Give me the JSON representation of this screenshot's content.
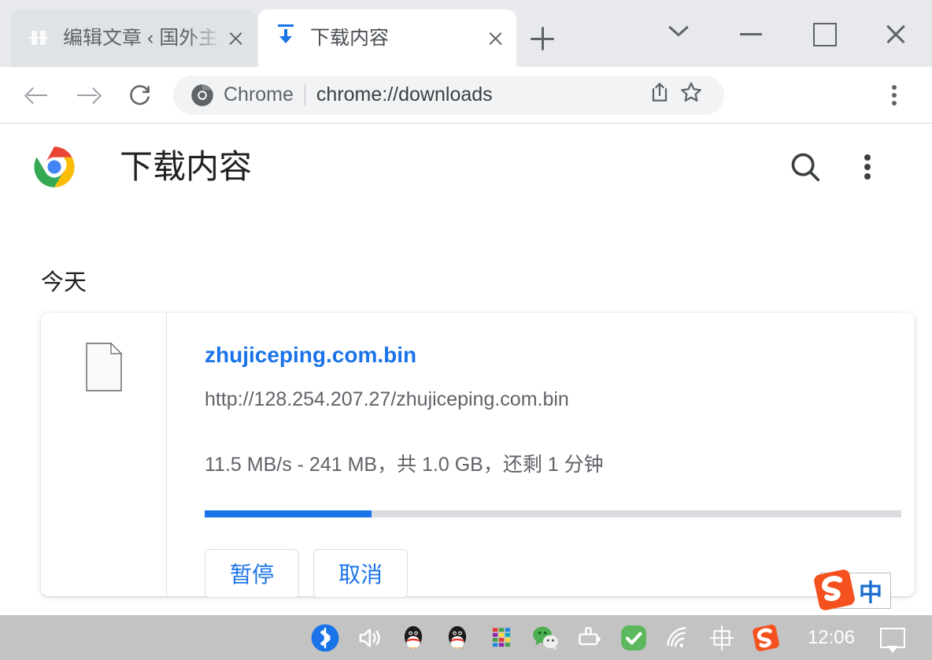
{
  "window": {
    "controls": {
      "tab_search": "tab-search",
      "minimize": "minimize",
      "maximize": "maximize",
      "close": "close"
    }
  },
  "tabs": [
    {
      "title": "编辑文章 ‹ 国外主",
      "favicon": "red-seal-icon",
      "active": false,
      "close_label": "×"
    },
    {
      "title": "下载内容",
      "favicon": "download-icon",
      "active": true,
      "close_label": "×"
    }
  ],
  "new_tab_label": "+",
  "toolbar": {
    "back": "back-arrow",
    "forward": "forward-arrow",
    "reload": "reload-icon",
    "omnibox": {
      "chip_label": "Chrome",
      "url": "chrome://downloads",
      "share_icon": "share-icon",
      "bookmark_icon": "star-icon"
    },
    "menu": "browser-menu"
  },
  "page": {
    "title": "下载内容",
    "watermark": "zhujiceping.com",
    "search_icon": "search-icon",
    "menu_icon": "more-vertical-icon",
    "date_group": "今天",
    "download": {
      "file_name": "zhujiceping.com.bin",
      "url": "http://128.254.207.27/zhujiceping.com.bin",
      "status": "11.5 MB/s - 241 MB，共 1.0 GB，还剩 1 分钟",
      "progress_percent": 24,
      "progress_color": "#1a73e8",
      "buttons": [
        {
          "label": "暂停",
          "name": "pause-button"
        },
        {
          "label": "取消",
          "name": "cancel-button"
        }
      ]
    }
  },
  "ime": {
    "mode_label": "中",
    "logo": "sogou-logo"
  },
  "taskbar": {
    "clock": "12:06",
    "tray_icons": [
      "bluetooth-icon",
      "volume-icon",
      "qq-icon",
      "qq-icon",
      "colorful-grid-icon",
      "wechat-icon",
      "battery-icon",
      "green-check-icon",
      "wifi-icon",
      "ime-chinese-icon",
      "sogou-icon"
    ],
    "notification_icon": "notification-icon"
  },
  "colors": {
    "accent": "#1a73e8",
    "tabstrip_bg": "#e7e9ec",
    "inactive_tab_bg": "#dfe2e6",
    "taskbar_bg": "#c3c3c3",
    "watermark": "#fbe0e0"
  }
}
